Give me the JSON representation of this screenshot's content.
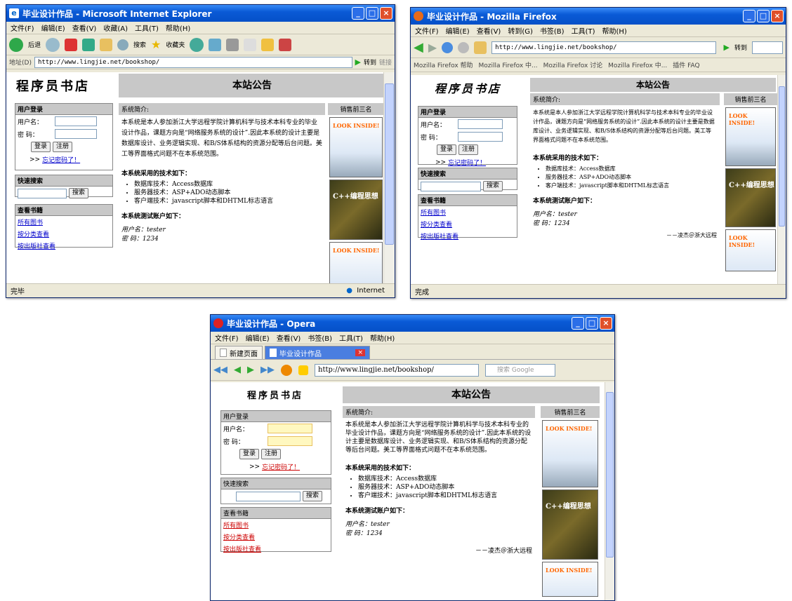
{
  "ie": {
    "title": "毕业设计作品 - Microsoft Internet Explorer",
    "menu": [
      "文件(F)",
      "编辑(E)",
      "查看(V)",
      "收藏(A)",
      "工具(T)",
      "帮助(H)"
    ],
    "back": "后退",
    "search": "搜索",
    "favorites": "收藏夹",
    "address_label": "地址(D)",
    "url": "http://www.lingjie.net/bookshop/",
    "go": "转到",
    "links": "链接",
    "status": "完毕",
    "zone": "Internet"
  },
  "ff": {
    "title": "毕业设计作品 - Mozilla Firefox",
    "menu": [
      "文件(F)",
      "编辑(E)",
      "查看(V)",
      "转到(G)",
      "书签(B)",
      "工具(T)",
      "帮助(H)"
    ],
    "url": "http://www.lingjie.net/bookshop/",
    "go": "转到",
    "bookmarks": [
      "Mozilla Firefox 帮助",
      "Mozilla Firefox 中...",
      "Mozilla Firefox 讨论",
      "Mozilla Firefox 中...",
      "插件 FAQ"
    ],
    "status": "完成"
  },
  "op": {
    "title": "毕业设计作品 - Opera",
    "menu": [
      "文件(F)",
      "编辑(E)",
      "查看(V)",
      "书签(B)",
      "工具(T)",
      "帮助(H)"
    ],
    "tabs": [
      "新建页面",
      "毕业设计作品"
    ],
    "url": "http://www.lingjie.net/bookshop/",
    "search_placeholder": "搜索 Google"
  },
  "site": {
    "logo": "程序员书店",
    "banner": "本站公告",
    "login_title": "用户登录",
    "username_label": "用户名：",
    "password_label": "密 码：",
    "login_btn": "登录",
    "register_btn": "注册",
    "forgot_prefix": ">>",
    "forgot": "忘记密码了！",
    "quick_search": "快速搜索",
    "search_btn": "搜索",
    "browse_title": "查看书籍",
    "browse": [
      "所有图书",
      "按分类查看",
      "按出版社查看"
    ],
    "intro_title": "系统简介:",
    "intro": "本系统是本人参加浙江大学远程学院计算机科学与技术本科专业的毕业设计作品，课题方向是“网络服务系统的设计”.因此本系统的设计主要是数据库设计、业务逻辑实现、和B/S体系结构的资源分配等后台问题。美工等界面格式问题不在本系统范围。",
    "tech_title": "本系统采用的技术如下：",
    "tech": [
      "数据库技术：Access数据库",
      "服务器技术：ASP+ADO动态脚本",
      "客户端技术：javascript脚本和DHTML标志语言"
    ],
    "acct_title": "本系统测试账户如下：",
    "acct_user": "用户名：tester",
    "acct_pass": "密 码：1234",
    "signature": "－－凌杰＠浙大远程",
    "top3": "销售前三名",
    "books": [
      "LOOK INSIDE!",
      "C++编程思想",
      "LOOK INSIDE!"
    ]
  },
  "colors": {
    "titlebar": "#0a5ad6",
    "panel_header": "#c8c8c8",
    "link": "#0000cc"
  }
}
